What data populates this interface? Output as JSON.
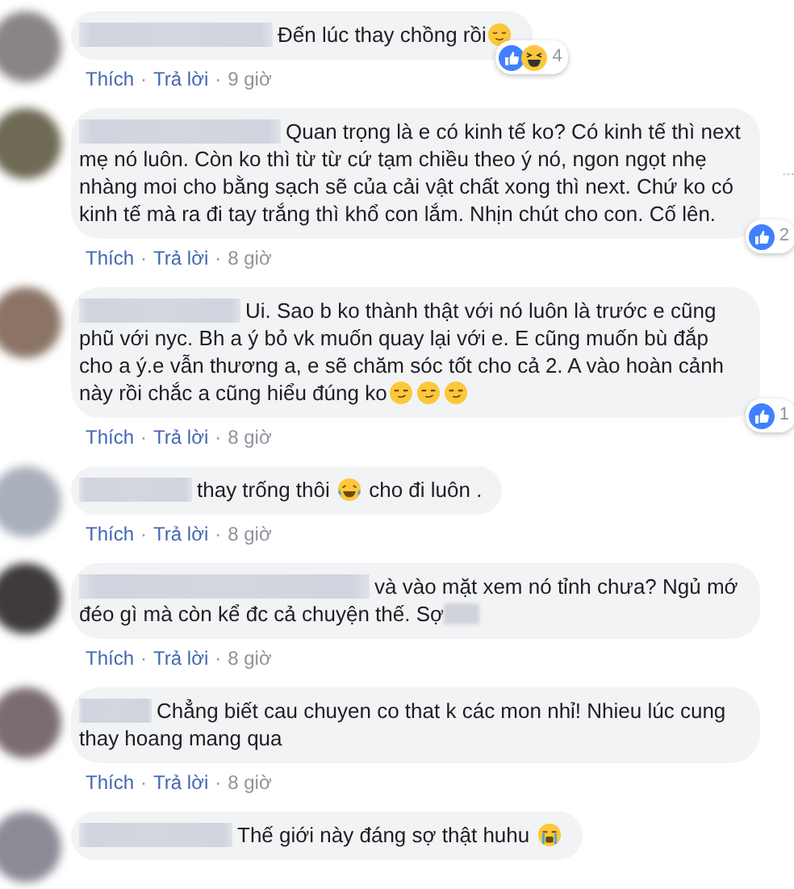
{
  "comments": [
    {
      "segments": [
        {
          "kind": "text",
          "text": "Đến lúc thay chồng rồi"
        },
        {
          "kind": "relieved"
        }
      ],
      "reactions": {
        "icons": [
          {
            "kind": "like"
          },
          {
            "kind": "haha"
          }
        ],
        "count": "4"
      },
      "more_menu": false,
      "actions": {
        "like": "Thích",
        "separator": "·",
        "reply": "Trả lời",
        "time": "9 giờ"
      }
    },
    {
      "segments": [
        {
          "kind": "text",
          "text": "Quan trọng là e có kinh tế ko? Có kinh tế thì next mẹ nó luôn. Còn ko thì từ từ cứ tạm chiều theo ý nó, ngon ngọt nhẹ nhàng moi cho bằng sạch sẽ của cải vật chất xong thì next. Chứ ko có kinh tế mà ra đi tay trắng thì khổ con lắm. Nhịn chút cho con. Cố lên."
        }
      ],
      "reactions": {
        "icons": [
          {
            "kind": "like"
          }
        ],
        "count": "2"
      },
      "more_menu": true,
      "actions": {
        "like": "Thích",
        "separator": "·",
        "reply": "Trả lời",
        "time": "8 giờ"
      }
    },
    {
      "segments": [
        {
          "kind": "text",
          "text": "Ui. Sao b ko thành thật với nó luôn là trước e cũng phũ với nyc. Bh a ý bỏ vk muốn quay lại với e. E cũng muốn bù đắp cho a ý.e vẫn thương a, e sẽ chăm sóc tốt cho cả 2. A vào hoàn cảnh này rồi chắc a cũng hiểu đúng ko",
          "tail": [
            {
              "kind": "smirk"
            },
            {
              "kind": "smirk"
            },
            {
              "kind": "smirk"
            }
          ]
        }
      ],
      "reactions": {
        "icons": [
          {
            "kind": "like"
          }
        ],
        "count": "1"
      },
      "more_menu": false,
      "actions": {
        "like": "Thích",
        "separator": "·",
        "reply": "Trả lời",
        "time": "8 giờ"
      }
    },
    {
      "segments": [
        {
          "kind": "text",
          "text": "thay trống thôi "
        },
        {
          "kind": "laugh"
        },
        {
          "kind": "text",
          "text": " cho đi luôn ."
        }
      ],
      "more_menu": false,
      "actions": {
        "like": "Thích",
        "separator": "·",
        "reply": "Trả lời",
        "time": "8 giờ"
      }
    },
    {
      "segments": [
        {
          "kind": "text",
          "text": "và vào mặt xem nó tỉnh chưa? Ngủ mớ đéo gì mà còn kể đc cả chuyện thế. Sợ",
          "tail": [
            {
              "kind": "blur"
            }
          ]
        }
      ],
      "more_menu": false,
      "actions": {
        "like": "Thích",
        "separator": "·",
        "reply": "Trả lời",
        "time": "8 giờ"
      }
    },
    {
      "segments": [
        {
          "kind": "text",
          "text": "Chẳng biết cau chuyen co that k các mon nhỉ! Nhieu lúc cung thay hoang mang qua"
        }
      ],
      "more_menu": false,
      "actions": {
        "like": "Thích",
        "separator": "·",
        "reply": "Trả lời",
        "time": "8 giờ"
      }
    },
    {
      "segments": [
        {
          "kind": "text",
          "text": "Thế giới này đáng sợ thật huhu "
        },
        {
          "kind": "cry"
        }
      ],
      "more_menu": false
    }
  ]
}
